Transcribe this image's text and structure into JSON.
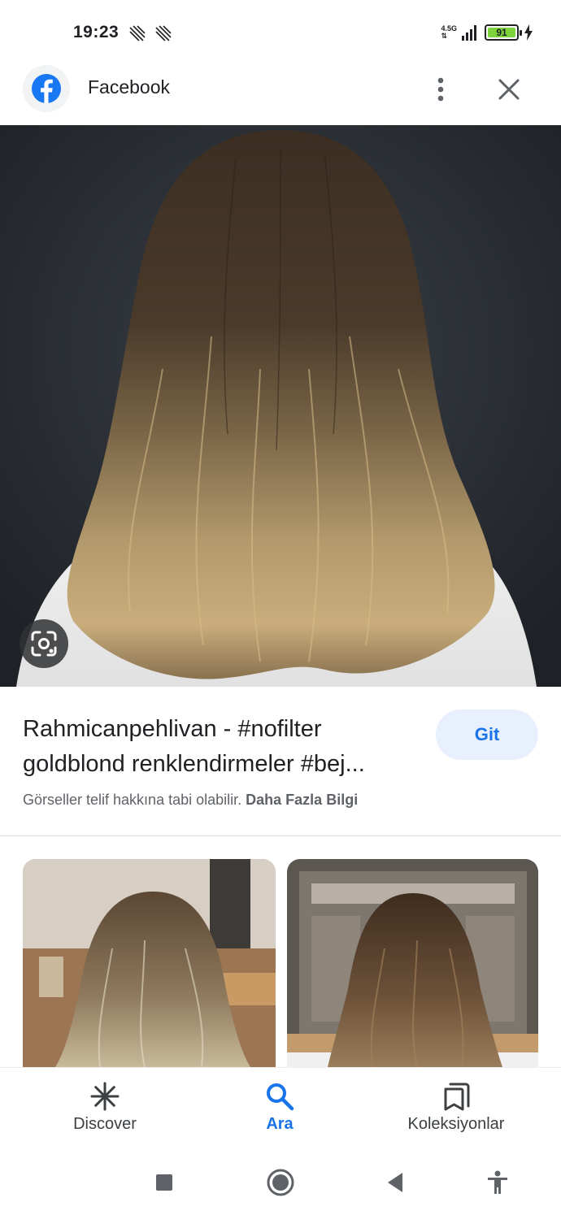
{
  "status_bar": {
    "time": "19:23",
    "network": "4.5G",
    "battery": "91",
    "battery_color": "#7dd33b"
  },
  "source": {
    "name": "Facebook",
    "logo_icon": "facebook-logo",
    "brand_color": "#1877f2"
  },
  "result": {
    "title_line_1": "Rahmicanpehlivan - #nofilter",
    "title_line_2": "goldblond renklendirmeler #bej...",
    "visit_label": "Git",
    "copyright_text": "Görseller telif hakkına tabi olabilir.",
    "learn_more": "Daha Fazla Bilgi"
  },
  "bottom_nav": {
    "items": [
      {
        "label": "Discover",
        "icon": "asterisk-icon",
        "active": false
      },
      {
        "label": "Ara",
        "icon": "search-icon",
        "active": true
      },
      {
        "label": "Koleksiyonlar",
        "icon": "bookmarks-icon",
        "active": false
      }
    ]
  },
  "colors": {
    "accent": "#1a73e8",
    "button_bg": "#e8f0fe",
    "muted_text": "#5f6368"
  }
}
